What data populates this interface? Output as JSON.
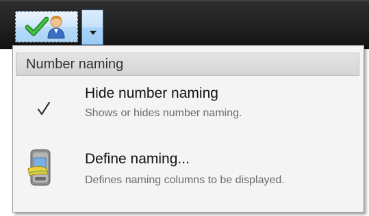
{
  "toolbar": {
    "main_button_icons": [
      "check-icon",
      "person-icon"
    ],
    "dropdown_icon": "chevron-down-icon"
  },
  "menu": {
    "header": "Number naming",
    "items": [
      {
        "title": "Hide number naming",
        "description": "Shows or hides number naming.",
        "icon": "checkmark-icon",
        "checked": true
      },
      {
        "title": "Define naming...",
        "description": "Defines naming columns to be displayed.",
        "icon": "phone-icon"
      }
    ]
  },
  "colors": {
    "toolbar_bg": "#1f1f1f",
    "menu_bg": "#f4f4f4",
    "header_bg": "#d9d9d9",
    "button_blue": "#b8dbf8",
    "check_green": "#2fa82f"
  }
}
